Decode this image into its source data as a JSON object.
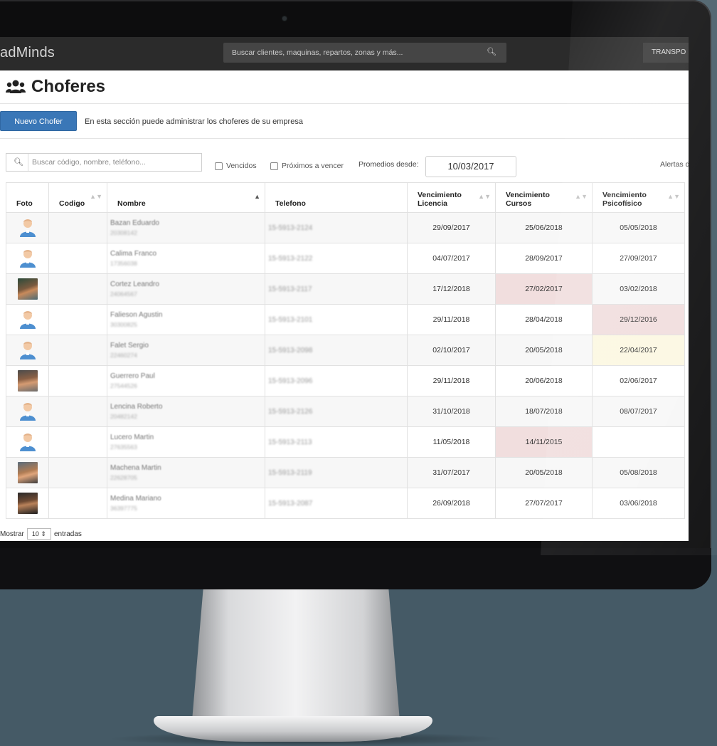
{
  "app": {
    "brand": "adMinds",
    "global_search_placeholder": "Buscar clientes, maquinas, repartos, zonas y más...",
    "org_label": "TRANSPO"
  },
  "page": {
    "title": "Choferes",
    "new_button": "Nuevo Chofer",
    "description": "En esta sección puede administrar los choferes de su empresa"
  },
  "filters": {
    "search_placeholder": "Buscar código, nombre, teléfono...",
    "vencidos_label": "Vencidos",
    "proximos_label": "Próximos a vencer",
    "promedios_label": "Promedios desde:",
    "promedios_date": "10/03/2017",
    "alertas_label": "Alertas d"
  },
  "table": {
    "headers": {
      "foto": "Foto",
      "codigo": "Codigo",
      "nombre": "Nombre",
      "telefono": "Telefono",
      "lic": "Vencimiento Licencia",
      "cur": "Vencimiento Cursos",
      "psi": "Vencimiento Psicofísico"
    },
    "rows": [
      {
        "photo": "avatar",
        "name": "Bazan Eduardo",
        "doc": "20308142",
        "tel": "15-5913-2124",
        "lic": "29/09/2017",
        "cur": "25/06/2018",
        "psi": "05/05/2018"
      },
      {
        "photo": "avatar",
        "name": "Calima Franco",
        "doc": "17356038",
        "tel": "15-5913-2122",
        "lic": "04/07/2017",
        "cur": "28/09/2017",
        "psi": "27/09/2017"
      },
      {
        "photo": "photo",
        "name": "Cortez Leandro",
        "doc": "24064567",
        "tel": "15-5913-2117",
        "lic": "17/12/2018",
        "cur": "27/02/2017",
        "psi": "03/02/2018"
      },
      {
        "photo": "avatar",
        "name": "Falieson Agustin",
        "doc": "30300825",
        "tel": "15-5913-2101",
        "lic": "29/11/2018",
        "cur": "28/04/2018",
        "psi": "29/12/2016"
      },
      {
        "photo": "avatar",
        "name": "Falet Sergio",
        "doc": "22460274",
        "tel": "15-5913-2098",
        "lic": "02/10/2017",
        "cur": "20/05/2018",
        "psi": "22/04/2017"
      },
      {
        "photo": "photo",
        "name": "Guerrero Paul",
        "doc": "27544526",
        "tel": "15-5913-2096",
        "lic": "29/11/2018",
        "cur": "20/06/2018",
        "psi": "02/06/2017"
      },
      {
        "photo": "avatar",
        "name": "Lencina Roberto",
        "doc": "20482142",
        "tel": "15-5913-2126",
        "lic": "31/10/2018",
        "cur": "18/07/2018",
        "psi": "08/07/2017"
      },
      {
        "photo": "avatar",
        "name": "Lucero Martin",
        "doc": "27635563",
        "tel": "15-5913-2113",
        "lic": "11/05/2018",
        "cur": "14/11/2015",
        "psi": ""
      },
      {
        "photo": "photo",
        "name": "Machena Martin",
        "doc": "22628705",
        "tel": "15-5913-2119",
        "lic": "31/07/2017",
        "cur": "20/05/2018",
        "psi": "05/08/2018"
      },
      {
        "photo": "photo",
        "name": "Medina Mariano",
        "doc": "36397775",
        "tel": "15-5913-2087",
        "lic": "26/09/2018",
        "cur": "27/07/2017",
        "psi": "03/06/2018"
      }
    ]
  },
  "footer": {
    "show_label": "Mostrar",
    "page_size": "10",
    "entries_label": "entradas"
  }
}
